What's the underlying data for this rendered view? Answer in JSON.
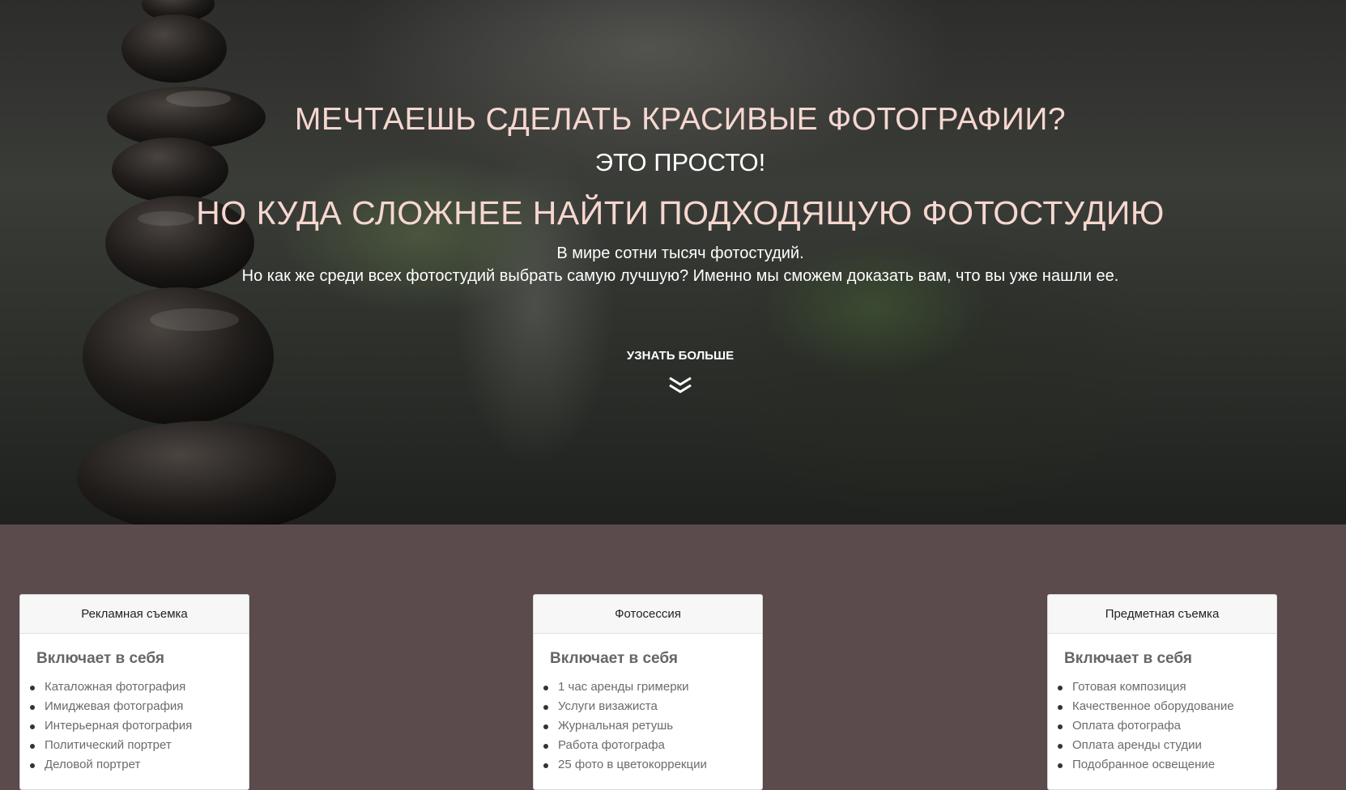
{
  "hero": {
    "headline": "МЕЧТАЕШЬ СДЕЛАТЬ КРАСИВЫЕ ФОТОГРАФИИ?",
    "subheadline": "ЭТО ПРОСТО!",
    "headline2": "НО КУДА СЛОЖНЕЕ НАЙТИ ПОДХОДЯЩУЮ ФОТОСТУДИЮ",
    "text1": "В мире сотни тысяч фотостудий.",
    "text2": "Но как же среди всех фотостудий выбрать самую лучшую? Именно мы сможем доказать вам, что вы уже нашли ее.",
    "more_label": "УЗНАТЬ БОЛЬШЕ",
    "more_icon": "double-chevron-down-icon"
  },
  "colors": {
    "headline": "#f6d7d0",
    "section_bg": "#5b4b4d",
    "card_header_bg": "#f7f7f7"
  },
  "cards": [
    {
      "header": "Рекламная съемка",
      "title": "Включает в себя",
      "items": [
        "Каталожная фотография",
        "Имиджевая фотография",
        "Интерьерная фотография",
        "Политический портрет",
        "Деловой портрет"
      ]
    },
    {
      "header": "Фотосессия",
      "title": "Включает в себя",
      "items": [
        "1 час аренды гримерки",
        "Услуги визажиста",
        "Журнальная ретушь",
        "Работа фотографа",
        "25 фото в цветокоррекции"
      ]
    },
    {
      "header": "Предметная съемка",
      "title": "Включает в себя",
      "items": [
        "Готовая композиция",
        "Качественное оборудование",
        "Оплата фотографа",
        "Оплата аренды студии",
        "Подобранное освещение"
      ]
    }
  ]
}
